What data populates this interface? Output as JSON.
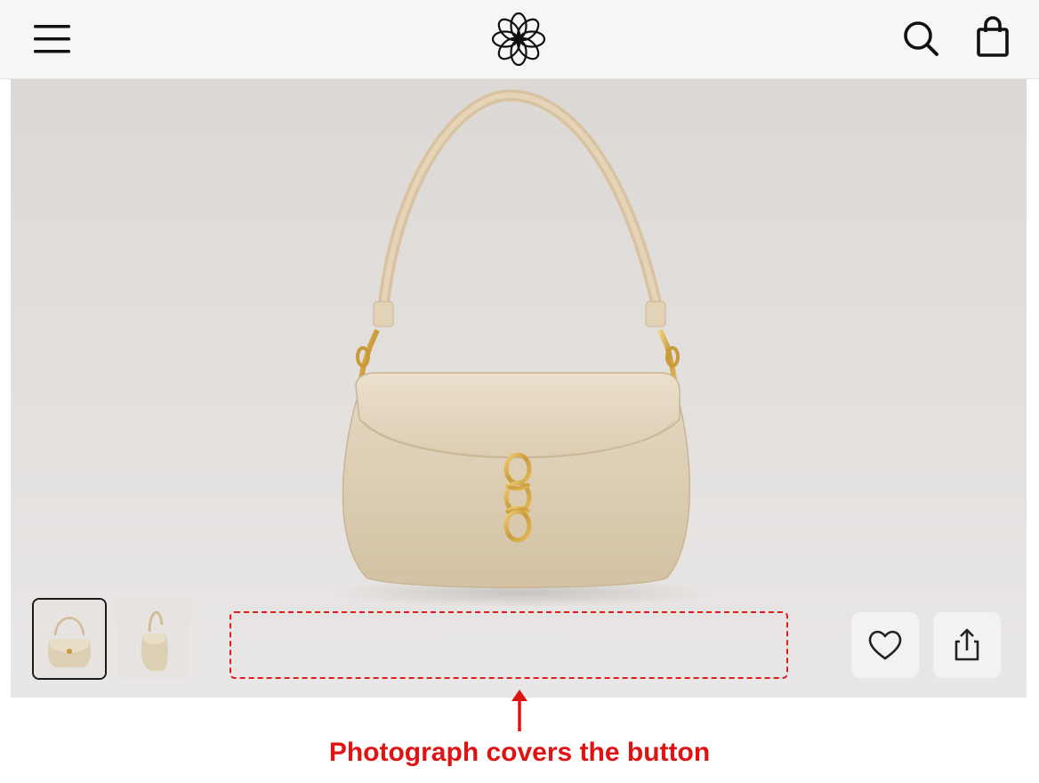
{
  "header": {
    "menu_icon": "hamburger-menu-icon",
    "logo_icon": "flower-logo-icon",
    "search_icon": "search-icon",
    "bag_icon": "shopping-bag-icon"
  },
  "gallery": {
    "main_image": "beige-leather-shoulder-bag",
    "thumbnails": [
      {
        "image": "bag-front-view",
        "selected": true
      },
      {
        "image": "bag-side-view",
        "selected": false
      }
    ]
  },
  "actions": {
    "wishlist_icon": "heart-icon",
    "share_icon": "share-icon"
  },
  "annotation": {
    "text": "Photograph covers the button",
    "color": "#e01313"
  },
  "colors": {
    "header_bg": "#f6f6f6",
    "photo_bg": "#e0dddb",
    "bag_leather": "#e3d5bd",
    "hardware_gold": "#c9a24a",
    "annotation_red": "#e01313"
  }
}
